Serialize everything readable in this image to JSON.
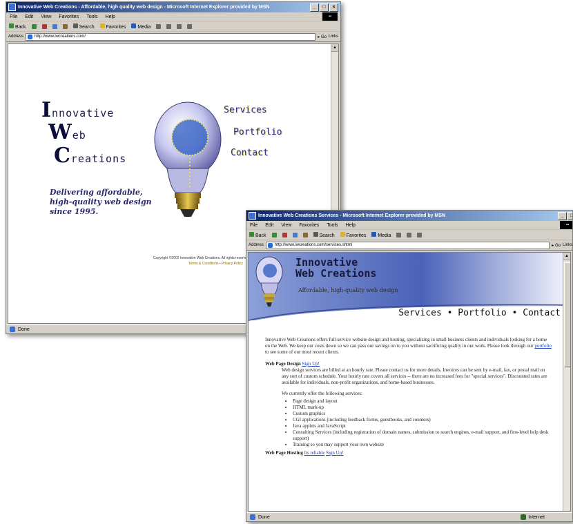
{
  "window1": {
    "title": "Innovative Web Creations - Affordable, high quality web design - Microsoft Internet Explorer provided by MSN",
    "menu": [
      "File",
      "Edit",
      "View",
      "Favorites",
      "Tools",
      "Help"
    ],
    "toolbar": {
      "back": "Back",
      "search": "Search",
      "favorites": "Favorites",
      "media": "Media"
    },
    "address_label": "Address",
    "address_value": "http://www.iwcreations.com/",
    "go_label": "Go",
    "links_label": "Links",
    "logo": {
      "line1_cap": "I",
      "line1_rest": "nnovative",
      "line2_cap": "W",
      "line2_rest": "eb",
      "line3_cap": "C",
      "line3_rest": "reations"
    },
    "tagline": [
      "Delivering affordable,",
      "high-quality web design",
      "since 1995."
    ],
    "nav": [
      "Services",
      "Portfolio",
      "Contact"
    ],
    "copyright": "Copyright ©2002 Innovative Web Creations. All rights reserved.",
    "footer_links": "Terms & Conditions • Privacy Policy",
    "status": "Done"
  },
  "window2": {
    "title": "Innovative Web Creations Services - Microsoft Internet Explorer provided by MSN",
    "menu": [
      "File",
      "Edit",
      "View",
      "Favorites",
      "Tools",
      "Help"
    ],
    "toolbar": {
      "back": "Back",
      "search": "Search",
      "favorites": "Favorites",
      "media": "Media"
    },
    "address_label": "Address",
    "address_value": "http://www.iwcreations.com/services.shtml",
    "go_label": "Go",
    "links_label": "Links",
    "banner_title_line1": "Innovative",
    "banner_title_line2": "Web Creations",
    "banner_subtitle": "Affordable, high-quality web design",
    "nav": "Services • Portfolio • Contact",
    "intro": "Innovative Web Creations offers full-service website design and hosting, specializing in small business clients and individuals looking for a home on the Web. We keep our costs down so we can pass our savings on to you without sacrificing quality in our work. Please look through our",
    "intro_link": "portfolio",
    "intro_end": "to see some of our most recent clients.",
    "section1_heading": "Web Page Design",
    "section1_link": "Sign Up!",
    "section1_text": "Web design services are billed at an hourly rate. Please contact us for more details. Invoices can be sent by e-mail, fax, or postal mail on any sort of custom schedule. Your hourly rate covers all services -- there are no increased fees for \"special services\". Discounted rates are available for individuals, non-profit organizations, and home-based businesses.",
    "services_intro": "We currently offer the following services:",
    "services": [
      "Page design and layout",
      "HTML mark-up",
      "Custom graphics",
      "CGI applications (including feedback forms, guestbooks, and counters)",
      "Java applets and JavaScript",
      "Consulting Services (including registration of domain names, submission to search engines, e-mail support, and first-level help desk support)",
      "Training so you may support your own website"
    ],
    "section2_heading": "Web Page Hosting",
    "section2_link1": "Its reliable",
    "section2_link2": "Sign Up!",
    "status": "Done",
    "zone": "Internet"
  }
}
